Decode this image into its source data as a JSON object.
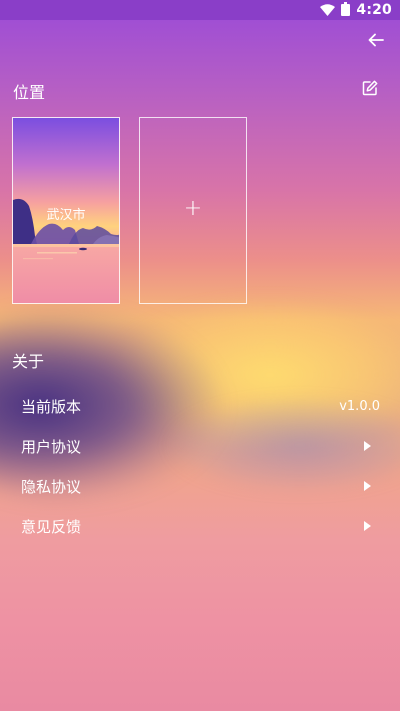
{
  "status_bar": {
    "time": "4:20",
    "icons": [
      "wifi-icon",
      "battery-icon"
    ]
  },
  "header": {
    "back_icon": "arrow-left-icon"
  },
  "location": {
    "title": "位置",
    "edit_icon": "edit-icon",
    "cities": [
      {
        "name": "武汉市"
      }
    ],
    "add_label": "+"
  },
  "about": {
    "title": "关于",
    "items": [
      {
        "label": "当前版本",
        "value": "v1.0.0"
      },
      {
        "label": "用户协议",
        "icon": "triangle-right-icon"
      },
      {
        "label": "隐私协议",
        "icon": "triangle-right-icon"
      },
      {
        "label": "意见反馈",
        "icon": "triangle-right-icon"
      }
    ]
  },
  "colors": {
    "status_bar": "#8a3ec8",
    "top_gradient": "#9a4ad8",
    "bottom_gradient": "#e98aa2",
    "text": "#ffffff"
  }
}
